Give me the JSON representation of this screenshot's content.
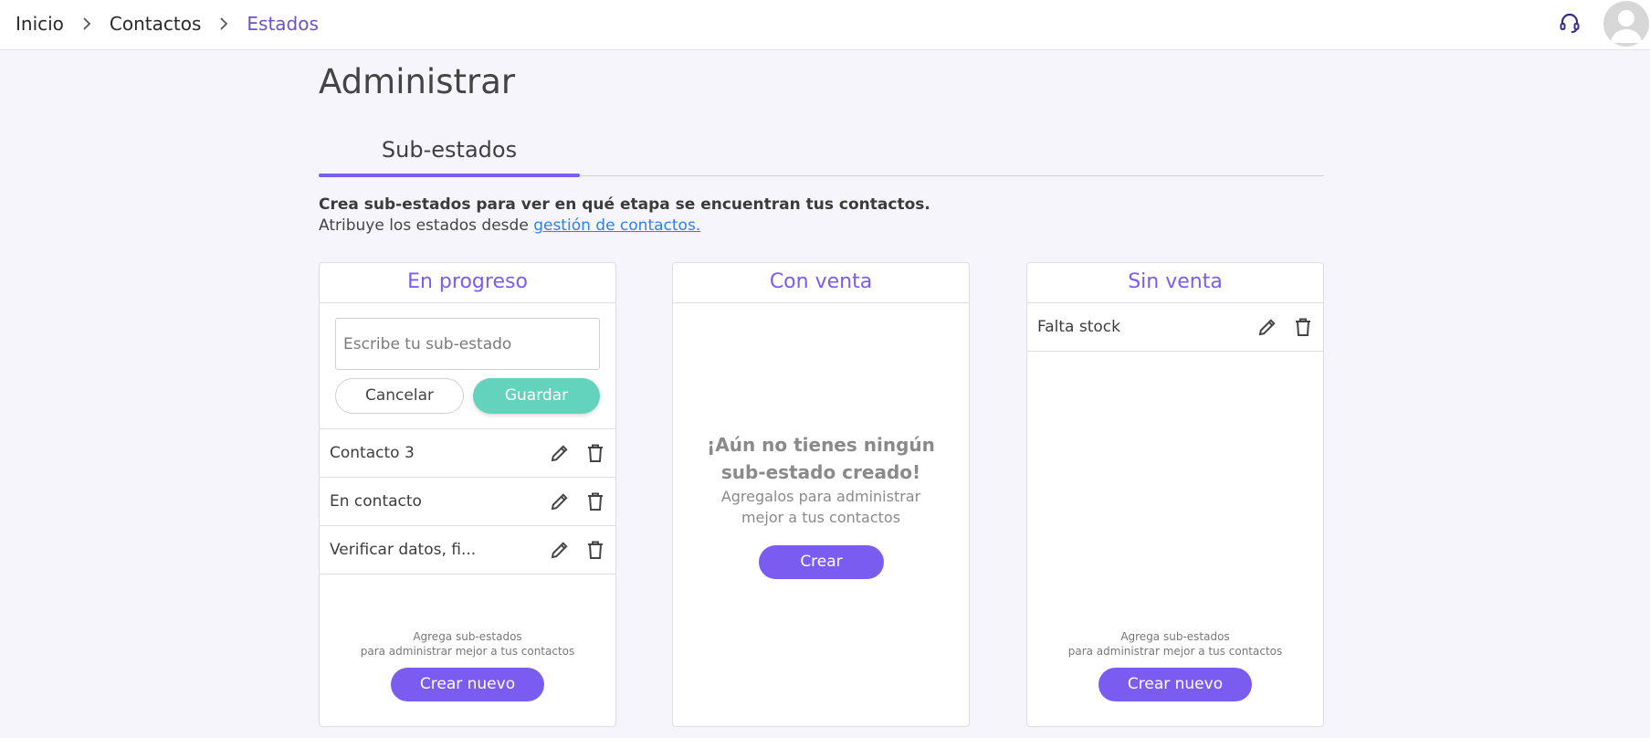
{
  "breadcrumb": {
    "items": [
      "Inicio",
      "Contactos",
      "Estados"
    ]
  },
  "header": {
    "support_icon": "headset-icon",
    "avatar_icon": "user-avatar-icon"
  },
  "page": {
    "title": "Administrar"
  },
  "tabs": [
    {
      "label": "Sub-estados",
      "active": true
    }
  ],
  "description": {
    "line1": "Crea sub-estados para ver en qué etapa se encuentran tus contactos.",
    "line2_prefix": "Atribuye los estados desde ",
    "line2_link": "gestión de contactos."
  },
  "columns": {
    "in_progress": {
      "title": "En progreso",
      "input_placeholder": "Escribe tu sub-estado",
      "cancel_label": "Cancelar",
      "save_label": "Guardar",
      "items": [
        "Contacto 3",
        "En contacto",
        "Verificar datos, fi..."
      ],
      "hint_line1": "Agrega sub-estados",
      "hint_line2": "para administrar mejor a tus contactos",
      "create_label": "Crear nuevo"
    },
    "with_sale": {
      "title": "Con venta",
      "empty_title_line1": "¡Aún no tienes ningún",
      "empty_title_line2": "sub-estado creado!",
      "empty_sub_line1": "Agregalos para administrar",
      "empty_sub_line2": "mejor a tus contactos",
      "create_label": "Crear"
    },
    "no_sale": {
      "title": "Sin venta",
      "items": [
        "Falta stock"
      ],
      "hint_line1": "Agrega sub-estados",
      "hint_line2": "para administrar mejor a tus contactos",
      "create_label": "Crear nuevo"
    }
  },
  "colors": {
    "accent": "#7b5cf0",
    "save": "#63d3bd",
    "breadcrumb_active": "#6a52c7",
    "link": "#2f80ed"
  }
}
